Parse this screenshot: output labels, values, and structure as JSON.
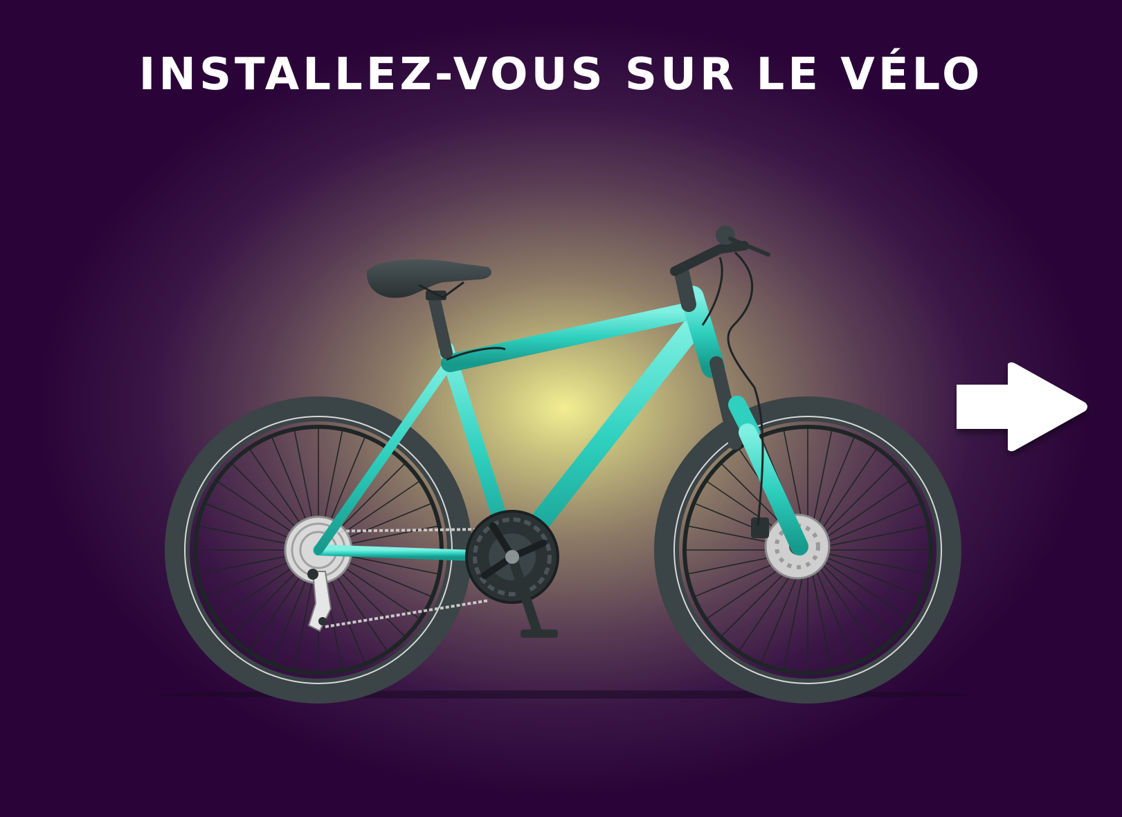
{
  "title": "INSTALLEZ-VOUS SUR LE VÉLO",
  "colors": {
    "background_dark": "#2a0438",
    "glow": "#f2ee92",
    "frame": "#2fd0bf",
    "tire": "#3b4446",
    "arrow": "#ffffff"
  },
  "icons": {
    "next": "arrow-right-icon",
    "illustration": "bicycle-icon"
  }
}
